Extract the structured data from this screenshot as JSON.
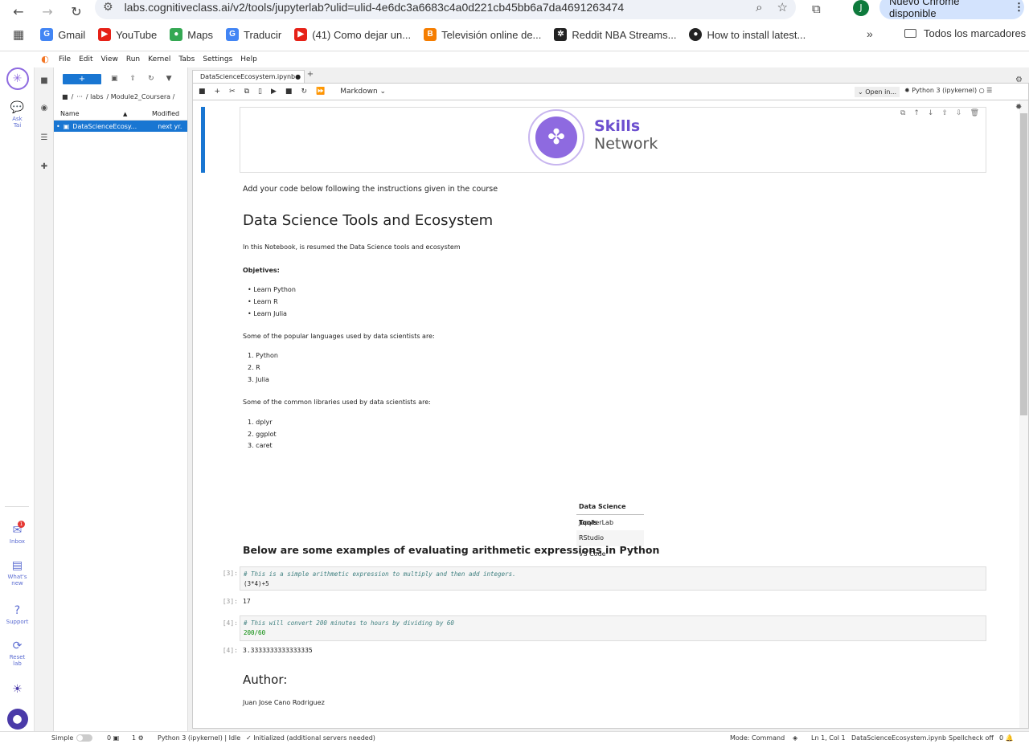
{
  "browser": {
    "url": "labs.cognitiveclass.ai/v2/tools/jupyterlab?ulid=ulid-4e6dc3a6683c4a0d221cb45bb6a7da4691263474",
    "profile_initial": "J",
    "update_label": "Nuevo Chrome disponible",
    "bookmarks": [
      {
        "label": "Gmail",
        "icon": "google-icon",
        "color": "#4285f4"
      },
      {
        "label": "YouTube",
        "icon": "youtube-icon",
        "color": "#e62117"
      },
      {
        "label": "Maps",
        "icon": "maps-icon",
        "color": "#34a853"
      },
      {
        "label": "Traducir",
        "icon": "translate-icon",
        "color": "#4285f4"
      },
      {
        "label": "(41) Como dejar un...",
        "icon": "youtube-icon",
        "color": "#e62117"
      },
      {
        "label": "Televisión online de...",
        "icon": "blogger-icon",
        "color": "#f57d00"
      },
      {
        "label": "Reddit NBA Streams...",
        "icon": "basketball-icon",
        "color": "#222222"
      },
      {
        "label": "How to install latest...",
        "icon": "github-icon",
        "color": "#222222"
      }
    ],
    "all_bookmarks": "Todos los marcadores"
  },
  "menu": [
    "File",
    "Edit",
    "View",
    "Run",
    "Kernel",
    "Tabs",
    "Settings",
    "Help"
  ],
  "rail": {
    "ask": "Ask\nTai",
    "inbox": "Inbox",
    "inbox_badge": "1",
    "whats_new": "What's\nnew",
    "support": "Support",
    "reset": "Reset\nlab"
  },
  "filebrowser": {
    "new_label": "+",
    "breadcrumb": [
      "/",
      "···",
      "/ labs",
      "/ Module2_Coursera /"
    ],
    "col_name": "Name",
    "col_modified": "Modified",
    "file_name": "DataScienceEcosy...",
    "file_modified": "next yr."
  },
  "notebook": {
    "tab_title": "DataScienceEcosystem.ipynb",
    "cell_type": "Markdown",
    "open_in": "Open in...",
    "kernel": "Python 3 (ipykernel)",
    "logo_skills": "Skills",
    "logo_network": "Network",
    "intro": "Add your code below following the instructions given in the course",
    "title": "Data Science Tools and Ecosystem",
    "summary": "In this Notebook, is resumed the Data Science tools and ecosystem",
    "objectives_heading": "Objetives:",
    "objectives": [
      "Learn Python",
      "Learn R",
      "Learn Julia"
    ],
    "languages_intro": "Some of the popular languages used by data scientists are:",
    "languages": [
      "1. Python",
      "2. R",
      "3. Julia"
    ],
    "libraries_intro": "Some of the common libraries used by data scientists are:",
    "libraries": [
      "1. dplyr",
      "2. ggplot",
      "3. caret"
    ],
    "table_header": "Data Science Tools",
    "table_rows": [
      "JupyterLab",
      "RStudio",
      "VS Code"
    ],
    "arith_heading": "Below are some examples of evaluating arithmetic expressions in Python",
    "cell3_prompt": "[3]:",
    "cell3_comment": "# This is a simple arithmetic expression to multiply and then add integers.",
    "cell3_code": "(3*4)+5",
    "cell3_out_prompt": "[3]:",
    "cell3_out": "17",
    "cell4_prompt": "[4]:",
    "cell4_comment": "# This will convert 200 minutes to hours by dividing by 60",
    "cell4_code": "200/60",
    "cell4_out_prompt": "[4]:",
    "cell4_out": "3.3333333333333335",
    "author_heading": "Author:",
    "author_name": "Juan Jose Cano Rodriguez"
  },
  "status": {
    "simple": "Simple",
    "zero": "0",
    "one": "1",
    "kernel": "Python 3 (ipykernel) | Idle",
    "init": "Initialized (additional servers needed)",
    "mode": "Mode: Command",
    "position": "Ln 1, Col 1",
    "file": "DataScienceEcosystem.ipynb",
    "spellcheck": "Spellcheck off",
    "notifications": "0"
  }
}
